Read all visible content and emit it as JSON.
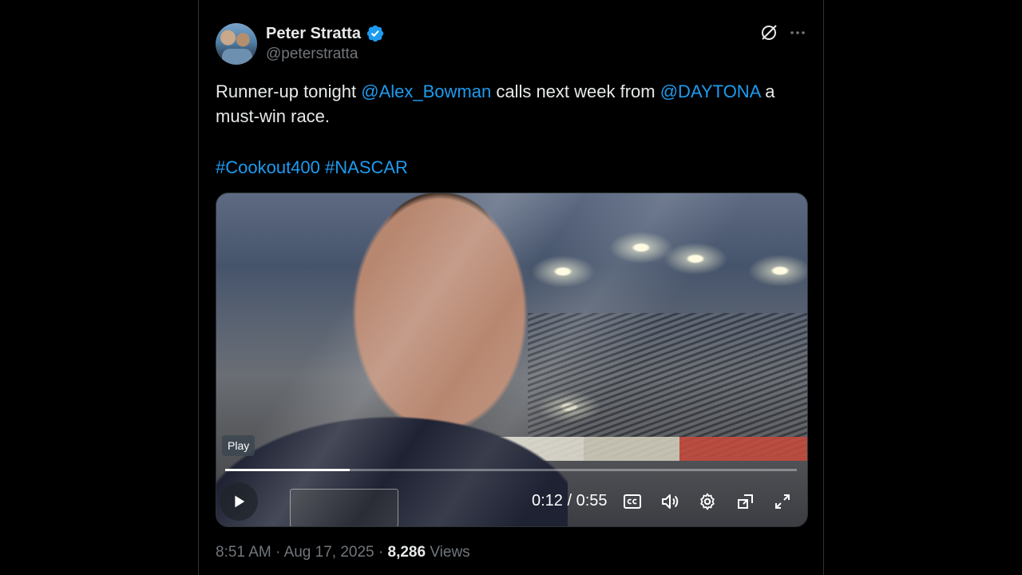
{
  "tweet": {
    "author_name": "Peter Stratta",
    "author_handle": "@peterstratta",
    "text_1": "Runner-up tonight ",
    "mention_1": "@Alex_Bowman",
    "text_2": " calls next week from ",
    "mention_2": "@DAYTONA",
    "text_3": " a must-win race.",
    "hashtag_1": "#Cookout400",
    "hashtag_2": "#NASCAR",
    "time": "8:51 AM",
    "separator": "·",
    "date": "Aug 17, 2025",
    "views_count": "8,286",
    "views_label": "Views"
  },
  "video": {
    "tooltip": "Play",
    "current_time": "0:12",
    "time_separator": "/",
    "duration": "0:55",
    "progress_fraction": 0.218
  },
  "icons": [
    "verified-badge-icon",
    "grok-icon",
    "more-icon",
    "play-icon",
    "captions-icon",
    "volume-icon",
    "settings-icon",
    "pip-icon",
    "fullscreen-icon"
  ],
  "colors": {
    "background": "#000000",
    "text": "#e7e9ea",
    "secondary": "#71767b",
    "accent": "#1d9bf0"
  }
}
